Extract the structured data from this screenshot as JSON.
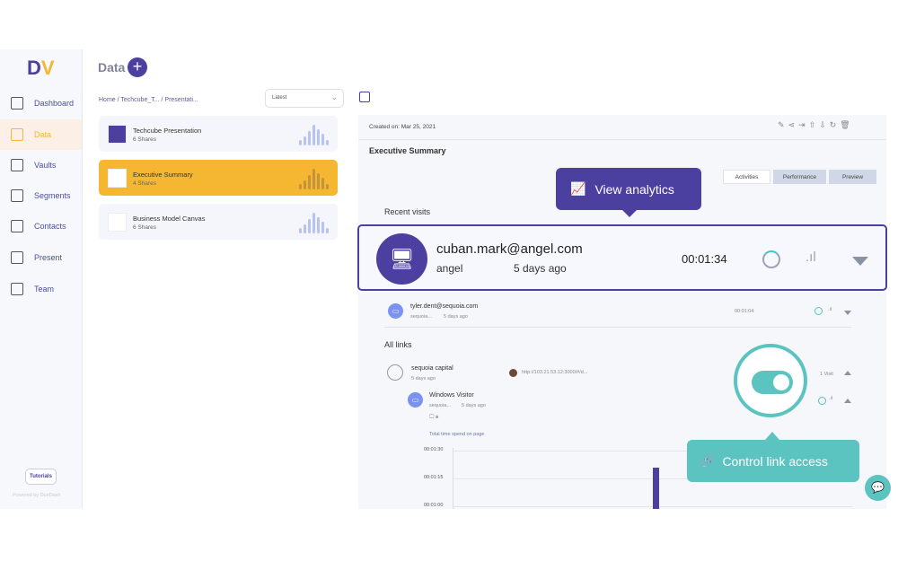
{
  "app": {
    "logo": "DV",
    "page_title": "Data",
    "add_button": "+"
  },
  "sidebar": {
    "items": [
      {
        "label": "Dashboard",
        "icon": "dashboard-icon"
      },
      {
        "label": "Data",
        "icon": "data-icon",
        "active": true
      },
      {
        "label": "Vaults",
        "icon": "vault-icon"
      },
      {
        "label": "Segments",
        "icon": "segments-icon"
      },
      {
        "label": "Contacts",
        "icon": "contacts-icon"
      },
      {
        "label": "Present",
        "icon": "present-icon"
      },
      {
        "label": "Team",
        "icon": "team-icon"
      }
    ],
    "tutorials": "Tutorials",
    "powered": "Powered by DueDash"
  },
  "breadcrumb": "Home / Techcube_T... / Presentati...",
  "sort": {
    "value": "Latest"
  },
  "documents": [
    {
      "name": "Techcube Presentation",
      "shares": "6 Shares"
    },
    {
      "name": "Executive Summary",
      "shares": "4 Shares",
      "selected": true
    },
    {
      "name": "Business Model Canvas",
      "shares": "6 Shares"
    }
  ],
  "detail": {
    "created": "Created on: Mar 25, 2021",
    "title": "Executive Summary",
    "tabs": [
      "Activities",
      "Performance",
      "Preview"
    ],
    "active_tab": "Activities",
    "recent_visits_label": "Recent visits",
    "all_links_label": "All links"
  },
  "visits": [
    {
      "email": "cuban.mark@angel.com",
      "org": "angel",
      "when": "5 days ago",
      "duration": "00:01:34"
    },
    {
      "email": "tyler.dent@sequoia.com",
      "org": "sequoia...",
      "when": "5 days ago",
      "duration": "00:01:04"
    }
  ],
  "links": {
    "name": "sequoia capital",
    "when": "5 days ago",
    "url": "http://103.21.53.12:3000/#/d...",
    "visits": "1 Visit",
    "visitor": {
      "name": "Windows Visitor",
      "org": "sequoia...",
      "when": "5 days ago"
    },
    "chart_label": "Total time spend on page"
  },
  "tooltips": {
    "analytics": "View analytics",
    "link_access": "Control link access"
  },
  "toggle": {
    "link_access_enabled": true
  },
  "colors": {
    "primary": "#4b3f9f",
    "accent": "#f5b731",
    "teal": "#5bc3c0"
  },
  "chart_data": {
    "type": "bar",
    "title": "Total time spend on page",
    "yticks": [
      "00:01:30",
      "00:01:15",
      "00:01:00"
    ],
    "values": [
      "00:01:21"
    ]
  }
}
